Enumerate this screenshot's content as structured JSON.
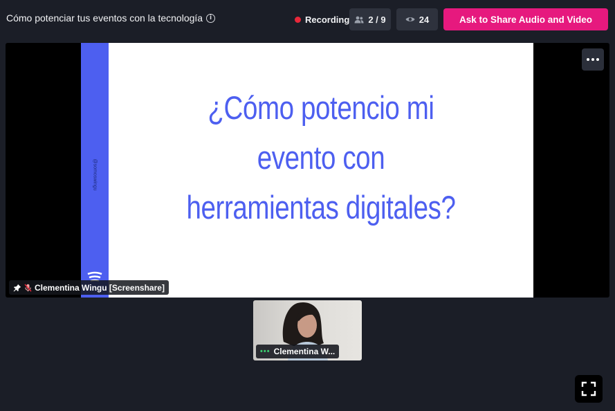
{
  "header": {
    "title": "Cómo potenciar tus eventos con la tecnología",
    "info_icon": "info-icon",
    "recording_label": "Recording",
    "participants": "2 / 9",
    "viewers": "24",
    "share_button": "Ask to Share Audio and Video"
  },
  "stage": {
    "slide": {
      "line1": "¿Cómo potencio mi",
      "line2": "evento con",
      "line3": "herramientas digitales?",
      "handle": "@somoswingu"
    },
    "screenshare_label": "Clementina Wingu [Screenshare]"
  },
  "thumbnail": {
    "name": "Clementina W..."
  },
  "colors": {
    "accent": "#e6197e",
    "slide_blue": "#4d5ff0",
    "recording": "#e8283a",
    "active_speaker": "#3ccf6e"
  }
}
